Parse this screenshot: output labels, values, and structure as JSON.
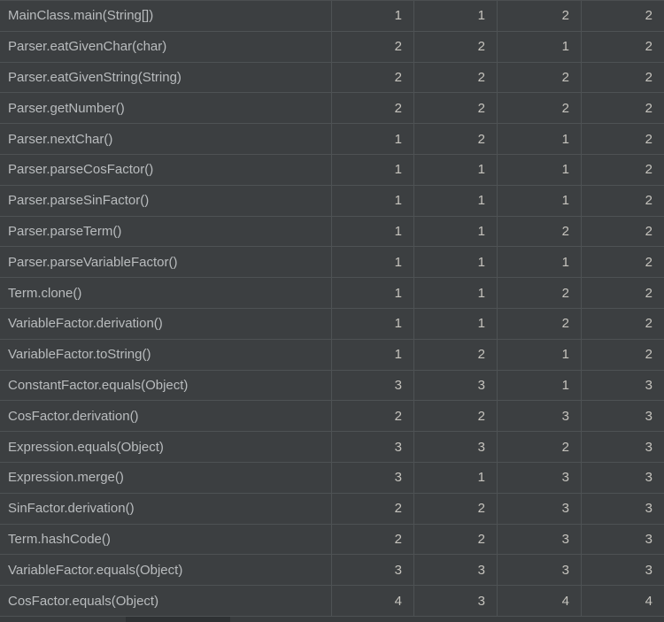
{
  "table": {
    "rows": [
      {
        "method": "MainClass.main(String[])",
        "values": [
          1,
          1,
          2,
          2
        ]
      },
      {
        "method": "Parser.eatGivenChar(char)",
        "values": [
          2,
          2,
          1,
          2
        ]
      },
      {
        "method": "Parser.eatGivenString(String)",
        "values": [
          2,
          2,
          2,
          2
        ]
      },
      {
        "method": "Parser.getNumber()",
        "values": [
          2,
          2,
          2,
          2
        ]
      },
      {
        "method": "Parser.nextChar()",
        "values": [
          1,
          2,
          1,
          2
        ]
      },
      {
        "method": "Parser.parseCosFactor()",
        "values": [
          1,
          1,
          1,
          2
        ]
      },
      {
        "method": "Parser.parseSinFactor()",
        "values": [
          1,
          1,
          1,
          2
        ]
      },
      {
        "method": "Parser.parseTerm()",
        "values": [
          1,
          1,
          2,
          2
        ]
      },
      {
        "method": "Parser.parseVariableFactor()",
        "values": [
          1,
          1,
          1,
          2
        ]
      },
      {
        "method": "Term.clone()",
        "values": [
          1,
          1,
          2,
          2
        ]
      },
      {
        "method": "VariableFactor.derivation()",
        "values": [
          1,
          1,
          2,
          2
        ]
      },
      {
        "method": "VariableFactor.toString()",
        "values": [
          1,
          2,
          1,
          2
        ]
      },
      {
        "method": "ConstantFactor.equals(Object)",
        "values": [
          3,
          3,
          1,
          3
        ]
      },
      {
        "method": "CosFactor.derivation()",
        "values": [
          2,
          2,
          3,
          3
        ]
      },
      {
        "method": "Expression.equals(Object)",
        "values": [
          3,
          3,
          2,
          3
        ]
      },
      {
        "method": "Expression.merge()",
        "values": [
          3,
          1,
          3,
          3
        ]
      },
      {
        "method": "SinFactor.derivation()",
        "values": [
          2,
          2,
          3,
          3
        ]
      },
      {
        "method": "Term.hashCode()",
        "values": [
          2,
          2,
          3,
          3
        ]
      },
      {
        "method": "VariableFactor.equals(Object)",
        "values": [
          3,
          3,
          3,
          3
        ]
      },
      {
        "method": "CosFactor.equals(Object)",
        "values": [
          4,
          3,
          4,
          4
        ]
      }
    ]
  },
  "colors": {
    "background": "#3c3f41",
    "grid_line": "#4e5254",
    "method_text": "#b9bcbe",
    "value_text": "#c6c4be",
    "scrollbar_track": "#393c3e",
    "scrollbar_thumb": "#2e3133"
  }
}
